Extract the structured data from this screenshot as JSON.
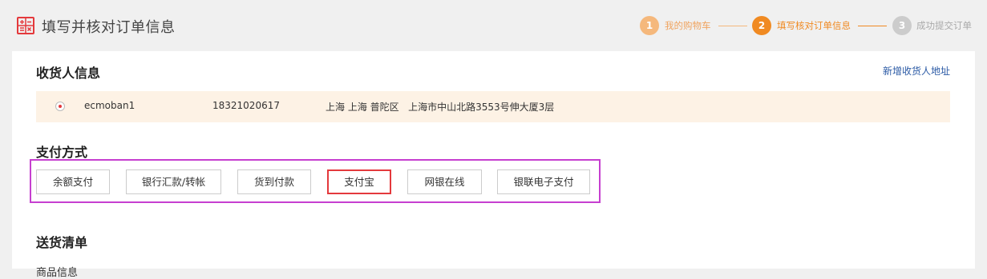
{
  "header": {
    "title": "填写并核对订单信息",
    "steps": [
      {
        "num": "1",
        "label": "我的购物车"
      },
      {
        "num": "2",
        "label": "填写核对订单信息"
      },
      {
        "num": "3",
        "label": "成功提交订单"
      }
    ]
  },
  "receiver": {
    "title": "收货人信息",
    "add_link": "新增收货人地址",
    "name": "ecmoban1",
    "phone": "18321020617",
    "address": "上海 上海 普陀区   上海市中山北路3553号伸大厦3层"
  },
  "payment": {
    "title": "支付方式",
    "methods": [
      "余额支付",
      "银行汇款/转帐",
      "货到付款",
      "支付宝",
      "网银在线",
      "银联电子支付"
    ],
    "selected": "支付宝"
  },
  "delivery": {
    "title": "送货清单",
    "cut_text": "商品信息"
  },
  "colors": {
    "accent": "#e4393c",
    "step_done": "#f5b87c",
    "step_active": "#f08a22",
    "step_pending": "#cccccc",
    "highlight": "#c63fd0",
    "link": "#2b5aa5"
  },
  "icons": {
    "title_icon": "calculator-icon"
  }
}
